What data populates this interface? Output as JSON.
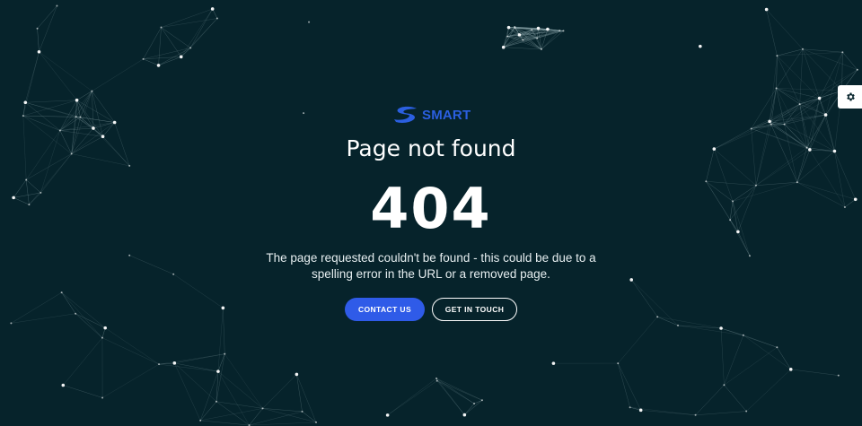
{
  "brand": {
    "name": "SMART",
    "color": "#2b5fe0",
    "logo_icon": "swoosh-s-icon"
  },
  "error": {
    "title": "Page not found",
    "code": "404",
    "description": "The page requested couldn't be found - this could be due to a spelling error in the URL or a removed page."
  },
  "actions": {
    "contact_label": "CONTACT US",
    "touch_label": "GET IN TOUCH"
  },
  "settings": {
    "icon": "gear-icon"
  },
  "colors": {
    "background": "#06232b",
    "primary_button": "#2f5be8",
    "network_lines": "#8fa9ae"
  }
}
